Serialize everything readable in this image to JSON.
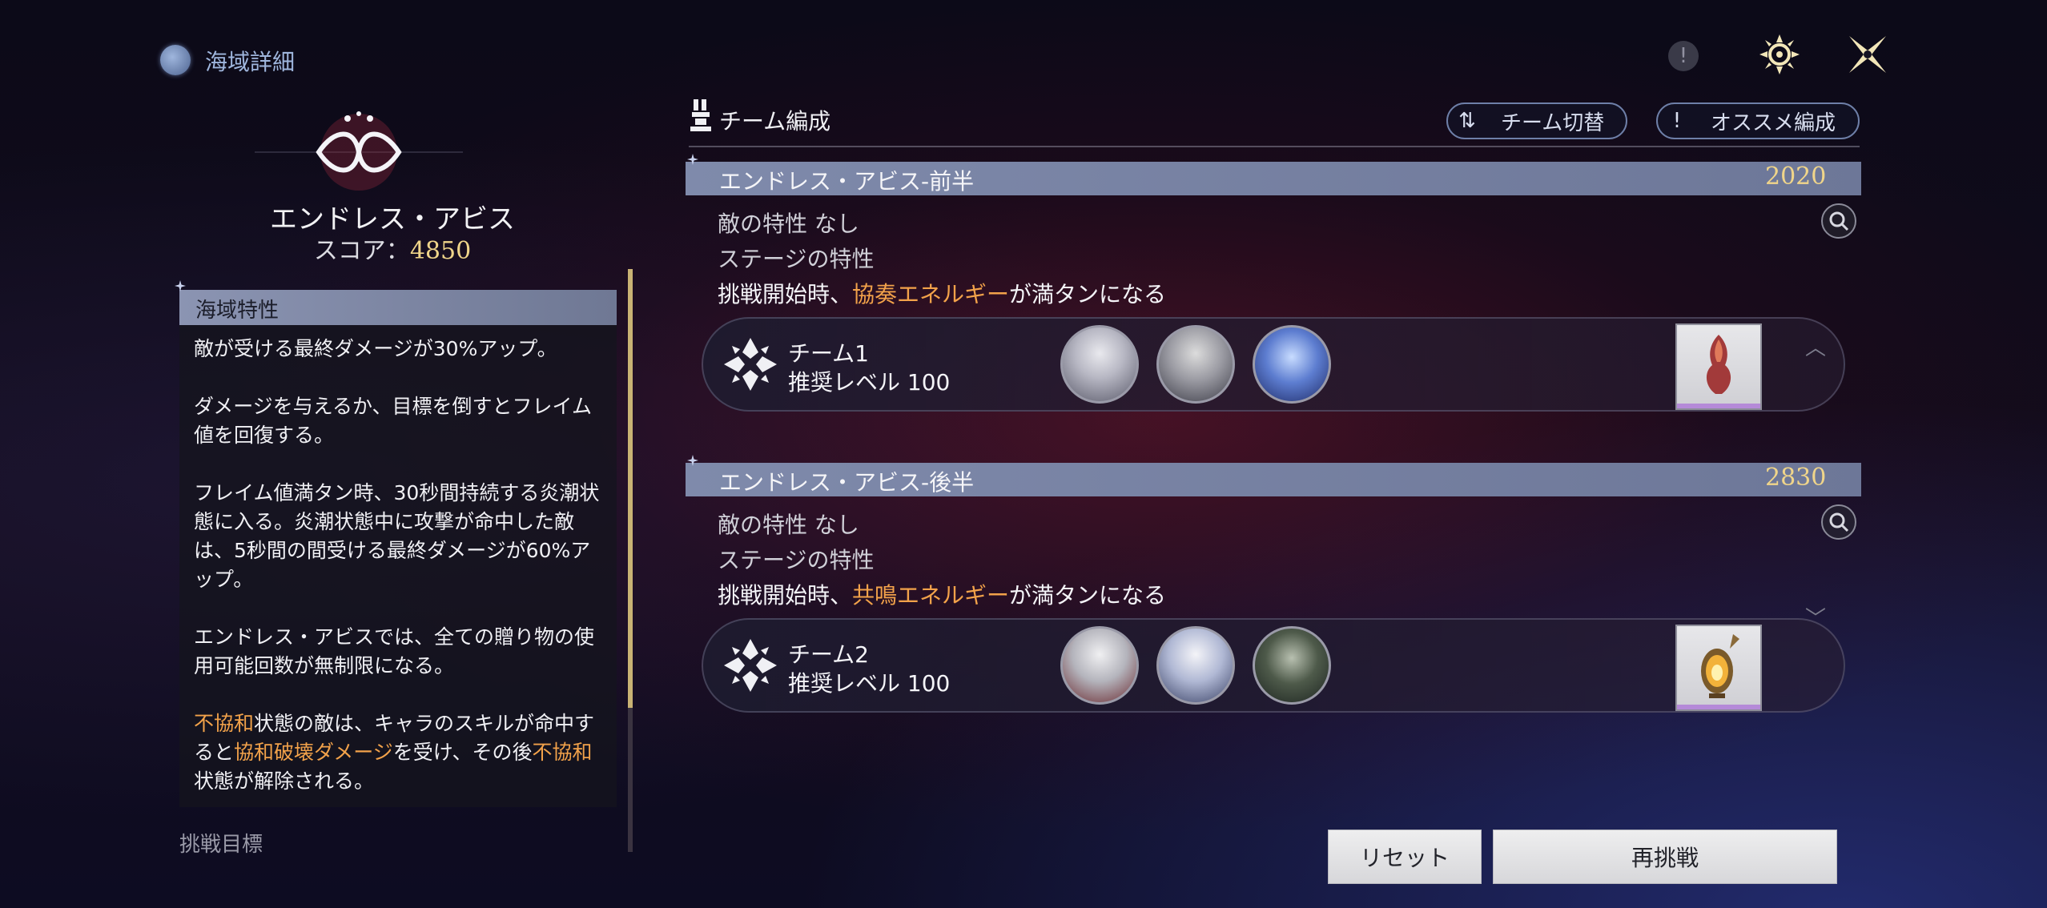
{
  "header": {
    "title": "海域詳細",
    "icon": "globe-icon"
  },
  "top_buttons": {
    "info_icon": "info-icon",
    "settings_icon": "settings-icon",
    "close_icon": "close-icon"
  },
  "stage": {
    "name": "エンドレス・アビス",
    "score_label": "スコア：",
    "score_value": "4850"
  },
  "traits": {
    "heading": "海域特性",
    "p1": "敵が受ける最終ダメージが30%アップ。",
    "p2": "ダメージを与えるか、目標を倒すとフレイム値を回復する。",
    "p3": "フレイム値満タン時、30秒間持続する炎潮状態に入る。炎潮状態中に攻撃が命中した敵は、5秒間の間受ける最終ダメージが60%アップ。",
    "p4": "エンドレス・アビスでは、全ての贈り物の使用可能回数が無制限になる。",
    "p5_hl1": "不協和",
    "p5_t1": "状態の敵は、キャラのスキルが命中すると",
    "p5_hl2": "協和破壊ダメージ",
    "p5_t2": "を受け、その後",
    "p5_hl3": "不協和",
    "p5_t3": "状態が解除される。",
    "next_section": "挑戦目標"
  },
  "team_section": {
    "title": "チーム編成",
    "switch_label": "チーム切替",
    "switch_glyph": "⇅",
    "recommend_label": "オススメ編成",
    "recommend_glyph": "!"
  },
  "halves": [
    {
      "title": "エンドレス・アビス-前半",
      "score": "2020",
      "enemy_trait": "敵の特性  なし",
      "stage_trait": "ステージの特性",
      "trait_pre": "挑戦開始時、",
      "trait_hl": "協奏エネルギー",
      "trait_post": "が満タンになる",
      "team_name": "チーム1",
      "team_level": "推奨レベル 100"
    },
    {
      "title": "エンドレス・アビス-後半",
      "score": "2830",
      "enemy_trait": "敵の特性  なし",
      "stage_trait": "ステージの特性",
      "trait_pre": "挑戦開始時、",
      "trait_hl": "共鳴エネルギー",
      "trait_post": "が満タンになる",
      "team_name": "チーム2",
      "team_level": "推奨レベル 100"
    }
  ],
  "buttons": {
    "reset": "リセット",
    "retry": "再挑戦"
  },
  "colors": {
    "accent_gold": "#f0d58a",
    "highlight_orange": "#f2a24a",
    "bar_blue": "#7f8aab"
  }
}
